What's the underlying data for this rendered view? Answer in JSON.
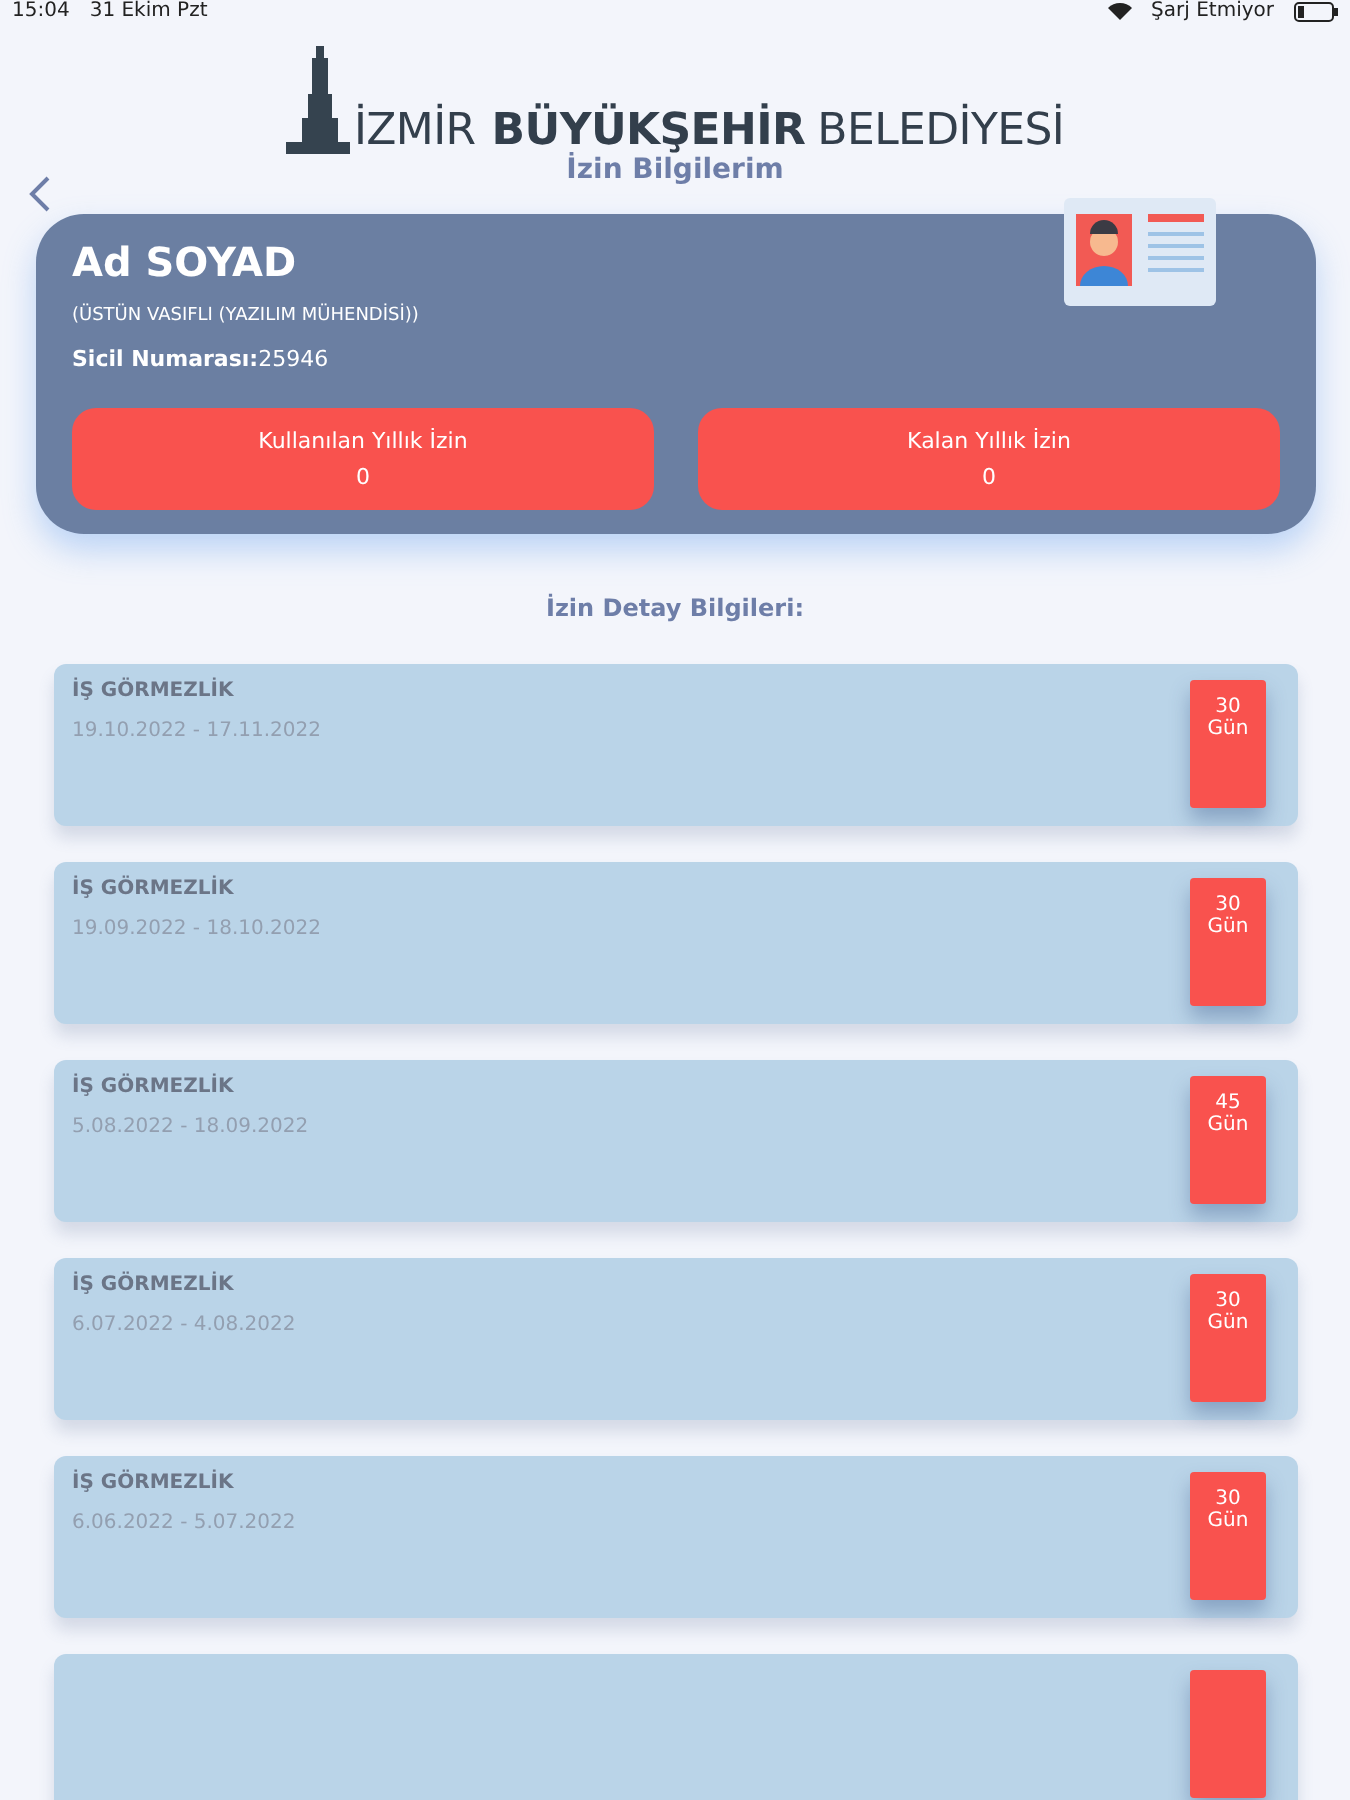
{
  "status_bar": {
    "time": "15:04",
    "date": "31 Ekim Pzt",
    "charging": "Şarj Etmiyor"
  },
  "logo": {
    "part_1": "İZMİR",
    "part_2": "BÜYÜKŞEHİR",
    "part_3": "BELEDİYESİ"
  },
  "page_title": "İzin Bilgilerim",
  "profile": {
    "name": "Ad SOYAD",
    "position": "(ÜSTÜN VASIFLI (YAZILIM MÜHENDİSİ))",
    "registry_label": "Sicil Numarası:",
    "registry_value": "25946",
    "stats": [
      {
        "label": "Kullanılan Yıllık İzin",
        "value": "0"
      },
      {
        "label": "Kalan Yıllık İzin",
        "value": "0"
      }
    ]
  },
  "section_title": "İzin Detay Bilgileri:",
  "leaves": [
    {
      "type": "İŞ GÖRMEZLİK",
      "dates": "19.10.2022 - 17.11.2022",
      "days": "30",
      "unit": "Gün"
    },
    {
      "type": "İŞ GÖRMEZLİK",
      "dates": "19.09.2022 - 18.10.2022",
      "days": "30",
      "unit": "Gün"
    },
    {
      "type": "İŞ GÖRMEZLİK",
      "dates": "5.08.2022 - 18.09.2022",
      "days": "45",
      "unit": "Gün"
    },
    {
      "type": "İŞ GÖRMEZLİK",
      "dates": "6.07.2022 - 4.08.2022",
      "days": "30",
      "unit": "Gün"
    },
    {
      "type": "İŞ GÖRMEZLİK",
      "dates": "6.06.2022 - 5.07.2022",
      "days": "30",
      "unit": "Gün"
    }
  ]
}
